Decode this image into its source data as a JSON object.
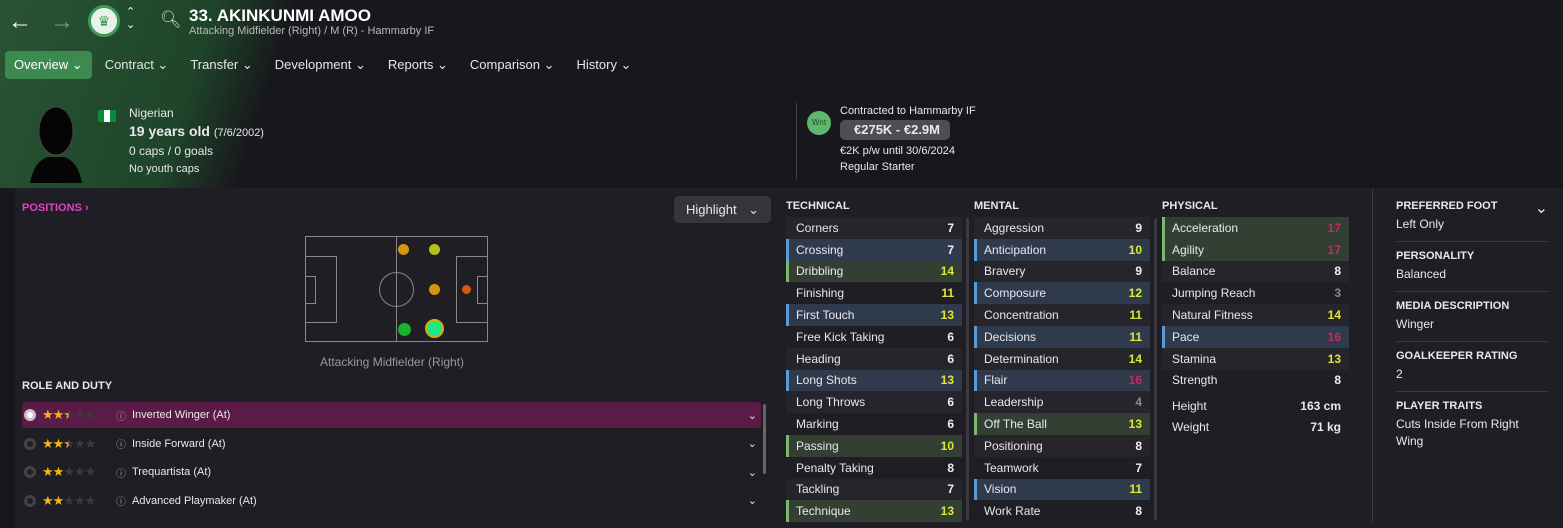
{
  "header": {
    "title": "33. AKINKUNMI AMOO",
    "subtitle": "Attacking Midfielder (Right) / M (R) - Hammarby IF",
    "back_icon": "arrow-left",
    "forward_icon": "arrow-right",
    "club_badge": "hammarby-crest"
  },
  "nav": [
    {
      "label": "Overview ⌄",
      "active": true
    },
    {
      "label": "Contract ⌄"
    },
    {
      "label": "Transfer ⌄"
    },
    {
      "label": "Development ⌄"
    },
    {
      "label": "Reports ⌄"
    },
    {
      "label": "Comparison ⌄"
    },
    {
      "label": "History ⌄"
    }
  ],
  "profile": {
    "nationality": "Nigerian",
    "age": "19 years old",
    "dob": "(7/6/2002)",
    "caps": "0 caps / 0 goals",
    "youth": "No youth caps"
  },
  "contract": {
    "status": "Contracted to Hammarby IF",
    "badge": "Wnt",
    "value": "€275K - €2.9M",
    "wage": "€2K p/w until 30/6/2024",
    "role": "Regular Starter"
  },
  "positions": {
    "title": "POSITIONS ›",
    "highlight": "Highlight",
    "label": "Attacking Midfielder (Right)"
  },
  "roles": {
    "title": "ROLE AND DUTY",
    "items": [
      {
        "name": "Inverted Winger (At)",
        "stars": 2.5,
        "selected": true
      },
      {
        "name": "Inside Forward (At)",
        "stars": 2.5
      },
      {
        "name": "Trequartista (At)",
        "stars": 2
      },
      {
        "name": "Advanced Playmaker (At)",
        "stars": 2
      }
    ]
  },
  "technical": {
    "title": "TECHNICAL",
    "rows": [
      [
        "Corners",
        7,
        ""
      ],
      [
        "Crossing",
        7,
        "blue"
      ],
      [
        "Dribbling",
        14,
        "green"
      ],
      [
        "Finishing",
        11,
        ""
      ],
      [
        "First Touch",
        13,
        "blue"
      ],
      [
        "Free Kick Taking",
        6,
        ""
      ],
      [
        "Heading",
        6,
        ""
      ],
      [
        "Long Shots",
        13,
        "blue"
      ],
      [
        "Long Throws",
        6,
        ""
      ],
      [
        "Marking",
        6,
        ""
      ],
      [
        "Passing",
        10,
        "green"
      ],
      [
        "Penalty Taking",
        8,
        ""
      ],
      [
        "Tackling",
        7,
        ""
      ],
      [
        "Technique",
        13,
        "green"
      ]
    ]
  },
  "mental": {
    "title": "MENTAL",
    "rows": [
      [
        "Aggression",
        9,
        ""
      ],
      [
        "Anticipation",
        10,
        "blue"
      ],
      [
        "Bravery",
        9,
        ""
      ],
      [
        "Composure",
        12,
        "blue"
      ],
      [
        "Concentration",
        11,
        ""
      ],
      [
        "Decisions",
        11,
        "blue"
      ],
      [
        "Determination",
        14,
        ""
      ],
      [
        "Flair",
        16,
        "blue"
      ],
      [
        "Leadership",
        4,
        ""
      ],
      [
        "Off The Ball",
        13,
        "green"
      ],
      [
        "Positioning",
        8,
        ""
      ],
      [
        "Teamwork",
        7,
        ""
      ],
      [
        "Vision",
        11,
        "blue"
      ],
      [
        "Work Rate",
        8,
        ""
      ]
    ]
  },
  "physical": {
    "title": "PHYSICAL",
    "rows": [
      [
        "Acceleration",
        17,
        "green"
      ],
      [
        "Agility",
        17,
        "green"
      ],
      [
        "Balance",
        8,
        ""
      ],
      [
        "Jumping Reach",
        3,
        ""
      ],
      [
        "Natural Fitness",
        14,
        ""
      ],
      [
        "Pace",
        16,
        "blue"
      ],
      [
        "Stamina",
        13,
        ""
      ],
      [
        "Strength",
        8,
        ""
      ]
    ],
    "height_label": "Height",
    "height": "163 cm",
    "weight_label": "Weight",
    "weight": "71 kg"
  },
  "info": [
    {
      "k": "PREFERRED FOOT",
      "v": "Left Only"
    },
    {
      "k": "PERSONALITY",
      "v": "Balanced"
    },
    {
      "k": "MEDIA DESCRIPTION",
      "v": "Winger"
    },
    {
      "k": "GOALKEEPER RATING",
      "v": "2"
    },
    {
      "k": "PLAYER TRAITS",
      "v": "Cuts Inside From Right Wing"
    }
  ],
  "colors": {
    "accent": "#3d8a50",
    "positions": "#e040c8",
    "high": "#dfe63a",
    "elite": "#c8295a",
    "low": "#8a8a8a",
    "role_selected": "#5a1b47"
  }
}
